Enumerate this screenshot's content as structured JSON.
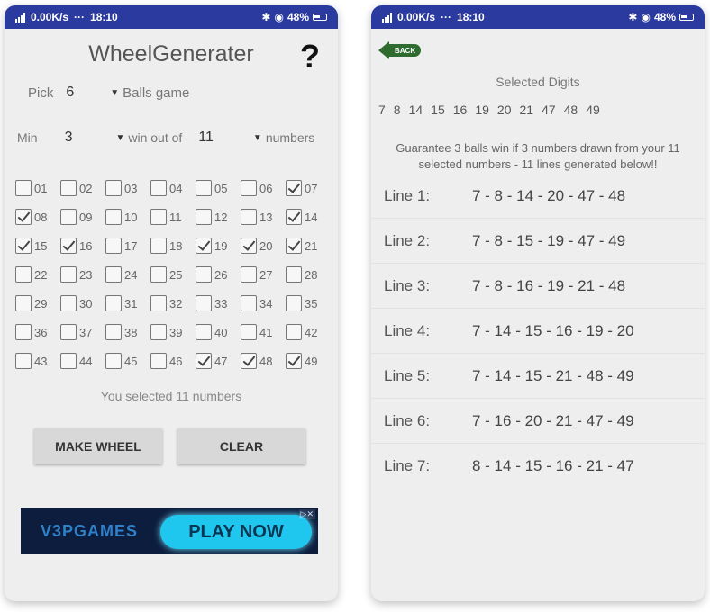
{
  "status_left": {
    "carrier": "0.00K/s",
    "time": "18:10"
  },
  "status_right": {
    "carrier": "0.00K/s",
    "time": "18:10"
  },
  "status_battery": "48%",
  "app": {
    "title": "WheelGenerater",
    "help": "?"
  },
  "pick": {
    "label": "Pick",
    "value": "6",
    "game": "Balls game"
  },
  "min": {
    "label": "Min",
    "value": "3",
    "win_label": "win out of",
    "out_of": "11",
    "numbers_label": "numbers"
  },
  "numbers": [
    {
      "n": "01",
      "c": false
    },
    {
      "n": "02",
      "c": false
    },
    {
      "n": "03",
      "c": false
    },
    {
      "n": "04",
      "c": false
    },
    {
      "n": "05",
      "c": false
    },
    {
      "n": "06",
      "c": false
    },
    {
      "n": "07",
      "c": true
    },
    {
      "n": "08",
      "c": true
    },
    {
      "n": "09",
      "c": false
    },
    {
      "n": "10",
      "c": false
    },
    {
      "n": "11",
      "c": false
    },
    {
      "n": "12",
      "c": false
    },
    {
      "n": "13",
      "c": false
    },
    {
      "n": "14",
      "c": true
    },
    {
      "n": "15",
      "c": true
    },
    {
      "n": "16",
      "c": true
    },
    {
      "n": "17",
      "c": false
    },
    {
      "n": "18",
      "c": false
    },
    {
      "n": "19",
      "c": true
    },
    {
      "n": "20",
      "c": true
    },
    {
      "n": "21",
      "c": true
    },
    {
      "n": "22",
      "c": false
    },
    {
      "n": "23",
      "c": false
    },
    {
      "n": "24",
      "c": false
    },
    {
      "n": "25",
      "c": false
    },
    {
      "n": "26",
      "c": false
    },
    {
      "n": "27",
      "c": false
    },
    {
      "n": "28",
      "c": false
    },
    {
      "n": "29",
      "c": false
    },
    {
      "n": "30",
      "c": false
    },
    {
      "n": "31",
      "c": false
    },
    {
      "n": "32",
      "c": false
    },
    {
      "n": "33",
      "c": false
    },
    {
      "n": "34",
      "c": false
    },
    {
      "n": "35",
      "c": false
    },
    {
      "n": "36",
      "c": false
    },
    {
      "n": "37",
      "c": false
    },
    {
      "n": "38",
      "c": false
    },
    {
      "n": "39",
      "c": false
    },
    {
      "n": "40",
      "c": false
    },
    {
      "n": "41",
      "c": false
    },
    {
      "n": "42",
      "c": false
    },
    {
      "n": "43",
      "c": false
    },
    {
      "n": "44",
      "c": false
    },
    {
      "n": "45",
      "c": false
    },
    {
      "n": "46",
      "c": false
    },
    {
      "n": "47",
      "c": true
    },
    {
      "n": "48",
      "c": true
    },
    {
      "n": "49",
      "c": true
    }
  ],
  "selected_text": "You selected 11 numbers",
  "buttons": {
    "make_wheel": "MAKE WHEEL",
    "clear": "CLEAR"
  },
  "ad": {
    "brand": "V3PGAMES",
    "cta": "PLAY NOW",
    "close": "▷✕"
  },
  "result": {
    "back_label": "BACK",
    "heading": "Selected Digits",
    "digits": [
      "7",
      "8",
      "14",
      "15",
      "16",
      "19",
      "20",
      "21",
      "47",
      "48",
      "49"
    ],
    "guarantee": "Guarantee 3 balls win if 3 numbers drawn from your 11 selected numbers - 11 lines generated below!!",
    "lines": [
      {
        "label": "Line 1:",
        "nums": "7 - 8 - 14 - 20 - 47 - 48"
      },
      {
        "label": "Line 2:",
        "nums": "7 - 8 - 15 - 19 - 47 - 49"
      },
      {
        "label": "Line 3:",
        "nums": "7 - 8 - 16 - 19 - 21 - 48"
      },
      {
        "label": "Line 4:",
        "nums": "7 - 14 - 15 - 16 - 19 - 20"
      },
      {
        "label": "Line 5:",
        "nums": "7 - 14 - 15 - 21 - 48 - 49"
      },
      {
        "label": "Line 6:",
        "nums": "7 - 16 - 20 - 21 - 47 - 49"
      },
      {
        "label": "Line 7:",
        "nums": "8 - 14 - 15 - 16 - 21 - 47"
      }
    ]
  },
  "colors": {
    "status_bar": "#2b3a9f",
    "back_arrow": "#2e6b2e",
    "ad_bg": "#0d1d3e",
    "ad_button": "#1fc7ee"
  },
  "icons": [
    "signal-icon",
    "bluetooth-icon",
    "eye-icon",
    "battery-icon",
    "help-icon",
    "dropdown-arrow-icon",
    "back-arrow-icon",
    "checkbox-icon"
  ]
}
